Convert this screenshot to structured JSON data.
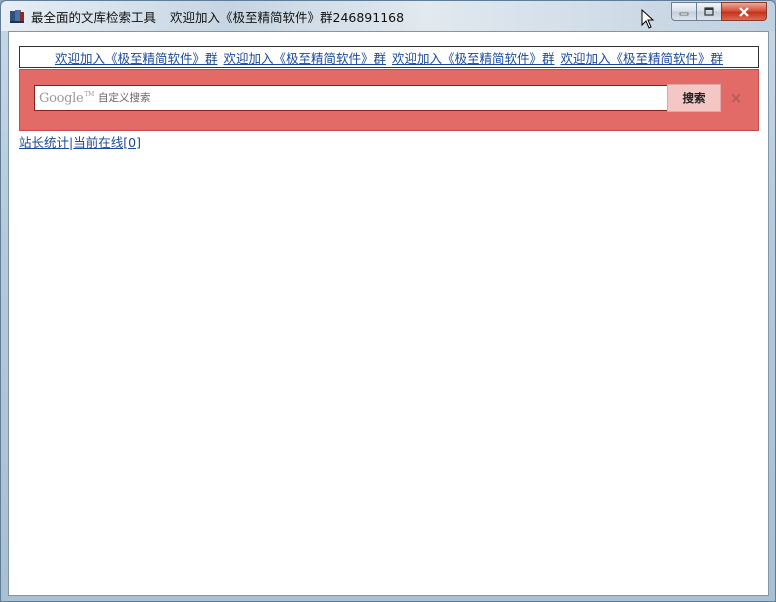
{
  "window": {
    "title": "最全面的文库检索工具",
    "subtitle": "欢迎加入《极至精简软件》群246891168"
  },
  "banner": {
    "links": [
      "欢迎加入《极至精简软件》群",
      "欢迎加入《极至精简软件》群",
      "欢迎加入《极至精简软件》群",
      "欢迎加入《极至精简软件》群"
    ]
  },
  "search": {
    "logo_text": "Google",
    "logo_tm": "TM",
    "placeholder": "自定义搜索",
    "button_label": "搜索",
    "clear_label": "×"
  },
  "footer": {
    "stats_link": "站长统计",
    "separator": "|",
    "online_link": "当前在线[0]"
  },
  "colors": {
    "search_panel": "#e26a67",
    "link": "#1a4a9a",
    "search_button": "#f4c6c4"
  }
}
